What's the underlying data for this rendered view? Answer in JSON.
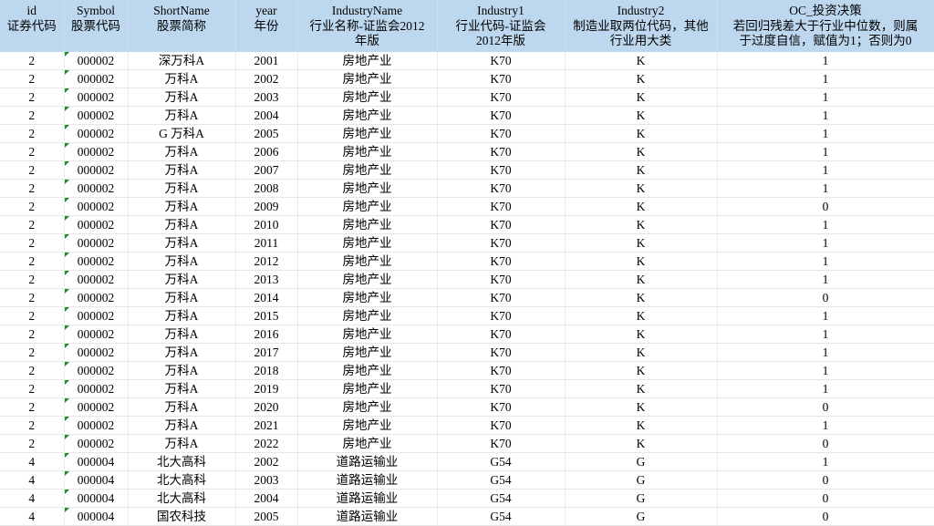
{
  "headers": [
    {
      "name": "id",
      "desc": [
        "",
        "证券代码"
      ]
    },
    {
      "name": "Symbol",
      "desc": [
        "",
        "股票代码"
      ]
    },
    {
      "name": "ShortName",
      "desc": [
        "",
        "股票简称"
      ]
    },
    {
      "name": "year",
      "desc": [
        "",
        "年份"
      ]
    },
    {
      "name": "IndustryName",
      "desc": [
        "行业名称-证监会2012",
        "年版"
      ]
    },
    {
      "name": "Industry1",
      "desc": [
        "行业代码-证监会",
        "2012年版"
      ]
    },
    {
      "name": "Industry2",
      "desc": [
        "制造业取两位代码，其他",
        "行业用大类"
      ]
    },
    {
      "name": "OC_投资决策",
      "desc": [
        "若回归残差大于行业中位数，则属",
        "于过度自信，赋值为1；否则为0"
      ]
    }
  ],
  "rows": [
    [
      "2",
      "000002",
      "深万科A",
      "2001",
      "房地产业",
      "K70",
      "K",
      "1"
    ],
    [
      "2",
      "000002",
      "万科A",
      "2002",
      "房地产业",
      "K70",
      "K",
      "1"
    ],
    [
      "2",
      "000002",
      "万科A",
      "2003",
      "房地产业",
      "K70",
      "K",
      "1"
    ],
    [
      "2",
      "000002",
      "万科A",
      "2004",
      "房地产业",
      "K70",
      "K",
      "1"
    ],
    [
      "2",
      "000002",
      "G 万科A",
      "2005",
      "房地产业",
      "K70",
      "K",
      "1"
    ],
    [
      "2",
      "000002",
      "万科A",
      "2006",
      "房地产业",
      "K70",
      "K",
      "1"
    ],
    [
      "2",
      "000002",
      "万科A",
      "2007",
      "房地产业",
      "K70",
      "K",
      "1"
    ],
    [
      "2",
      "000002",
      "万科A",
      "2008",
      "房地产业",
      "K70",
      "K",
      "1"
    ],
    [
      "2",
      "000002",
      "万科A",
      "2009",
      "房地产业",
      "K70",
      "K",
      "0"
    ],
    [
      "2",
      "000002",
      "万科A",
      "2010",
      "房地产业",
      "K70",
      "K",
      "1"
    ],
    [
      "2",
      "000002",
      "万科A",
      "2011",
      "房地产业",
      "K70",
      "K",
      "1"
    ],
    [
      "2",
      "000002",
      "万科A",
      "2012",
      "房地产业",
      "K70",
      "K",
      "1"
    ],
    [
      "2",
      "000002",
      "万科A",
      "2013",
      "房地产业",
      "K70",
      "K",
      "1"
    ],
    [
      "2",
      "000002",
      "万科A",
      "2014",
      "房地产业",
      "K70",
      "K",
      "0"
    ],
    [
      "2",
      "000002",
      "万科A",
      "2015",
      "房地产业",
      "K70",
      "K",
      "1"
    ],
    [
      "2",
      "000002",
      "万科A",
      "2016",
      "房地产业",
      "K70",
      "K",
      "1"
    ],
    [
      "2",
      "000002",
      "万科A",
      "2017",
      "房地产业",
      "K70",
      "K",
      "1"
    ],
    [
      "2",
      "000002",
      "万科A",
      "2018",
      "房地产业",
      "K70",
      "K",
      "1"
    ],
    [
      "2",
      "000002",
      "万科A",
      "2019",
      "房地产业",
      "K70",
      "K",
      "1"
    ],
    [
      "2",
      "000002",
      "万科A",
      "2020",
      "房地产业",
      "K70",
      "K",
      "0"
    ],
    [
      "2",
      "000002",
      "万科A",
      "2021",
      "房地产业",
      "K70",
      "K",
      "1"
    ],
    [
      "2",
      "000002",
      "万科A",
      "2022",
      "房地产业",
      "K70",
      "K",
      "0"
    ],
    [
      "4",
      "000004",
      "北大高科",
      "2002",
      "道路运输业",
      "G54",
      "G",
      "1"
    ],
    [
      "4",
      "000004",
      "北大高科",
      "2003",
      "道路运输业",
      "G54",
      "G",
      "0"
    ],
    [
      "4",
      "000004",
      "北大高科",
      "2004",
      "道路运输业",
      "G54",
      "G",
      "0"
    ],
    [
      "4",
      "000004",
      "国农科技",
      "2005",
      "道路运输业",
      "G54",
      "G",
      "0"
    ]
  ]
}
